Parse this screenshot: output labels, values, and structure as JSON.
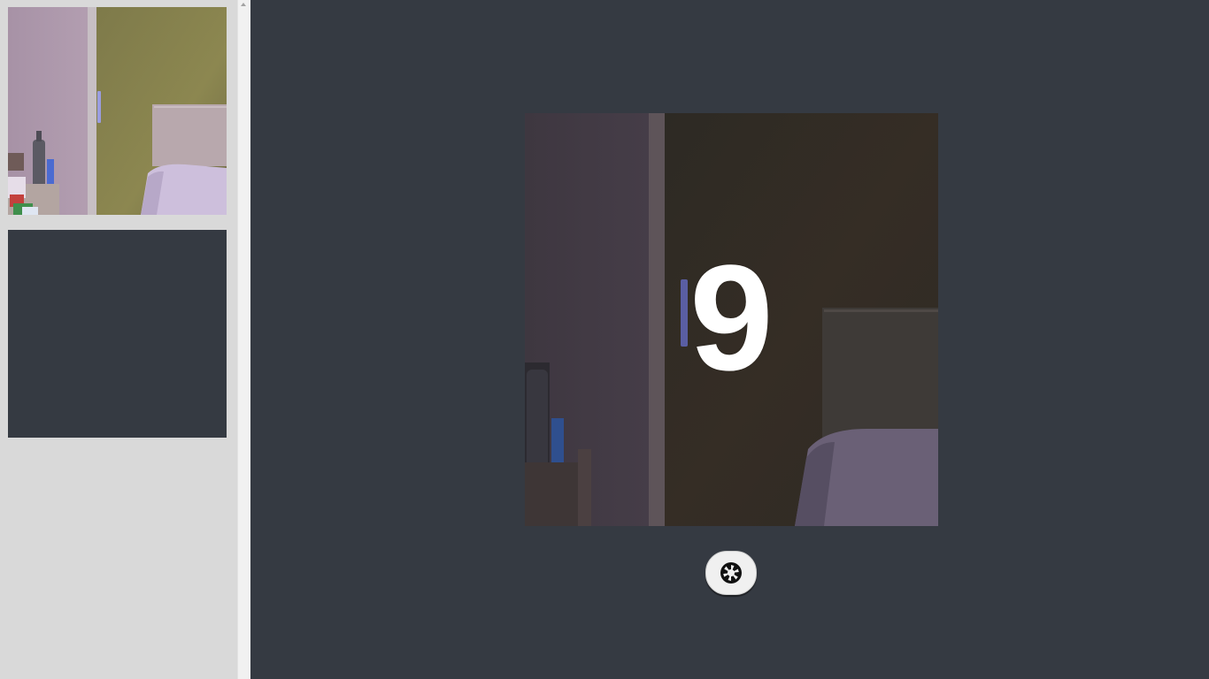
{
  "thumbnails": [
    {
      "kind": "photo",
      "description_icon": "captured-photo"
    },
    {
      "kind": "empty"
    }
  ],
  "camera": {
    "countdown": "9"
  },
  "shutter": {
    "icon": "aperture-icon"
  },
  "colors": {
    "background": "#353a42",
    "sidebar": "#d9d9d9",
    "button": "#f0f0f0",
    "countdown_text": "#ffffff"
  }
}
